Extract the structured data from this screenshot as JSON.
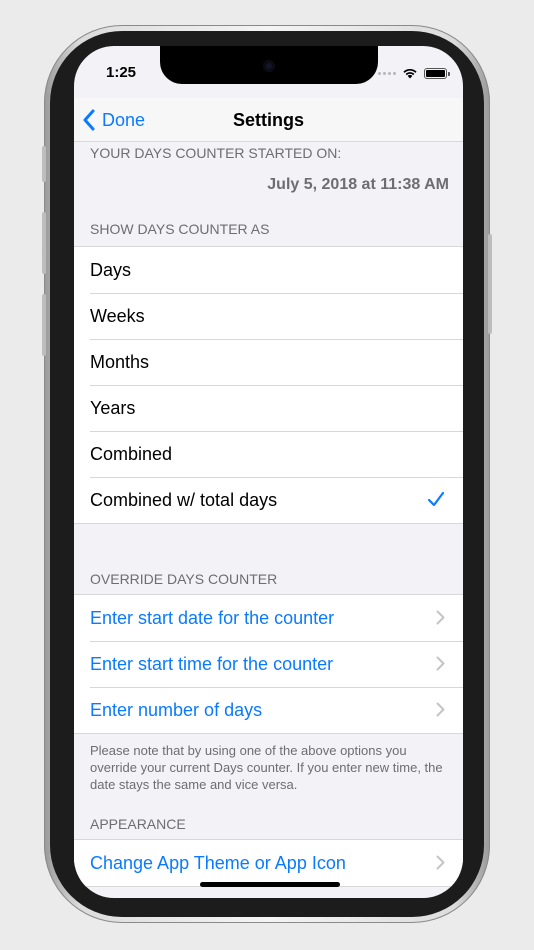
{
  "status": {
    "time": "1:25"
  },
  "nav": {
    "back_label": "Done",
    "title": "Settings"
  },
  "counter_started": {
    "header": "YOUR DAYS COUNTER STARTED ON:",
    "value": "July 5, 2018 at 11:38 AM"
  },
  "show_as": {
    "header": "SHOW DAYS COUNTER AS",
    "options": [
      {
        "label": "Days"
      },
      {
        "label": "Weeks"
      },
      {
        "label": "Months"
      },
      {
        "label": "Years"
      },
      {
        "label": "Combined"
      },
      {
        "label": "Combined w/ total days"
      }
    ],
    "selected": "Combined w/ total days"
  },
  "override": {
    "header": "OVERRIDE DAYS COUNTER",
    "items": [
      {
        "label": "Enter start date for the counter"
      },
      {
        "label": "Enter start time for the counter"
      },
      {
        "label": "Enter number of days"
      }
    ],
    "note": "Please note that by using one of the above options you override your current Days counter. If you enter new time, the date stays the same and vice versa."
  },
  "appearance": {
    "header": "APPEARANCE",
    "items": [
      {
        "label": "Change App Theme or App Icon"
      }
    ]
  },
  "colors": {
    "accent": "#0a7aff",
    "secondary_text": "#6d6d72",
    "background": "#f2f2f7"
  },
  "icons": {
    "back": "chevron-left-icon",
    "selected": "checkmark-icon",
    "disclosure": "chevron-right-icon"
  }
}
